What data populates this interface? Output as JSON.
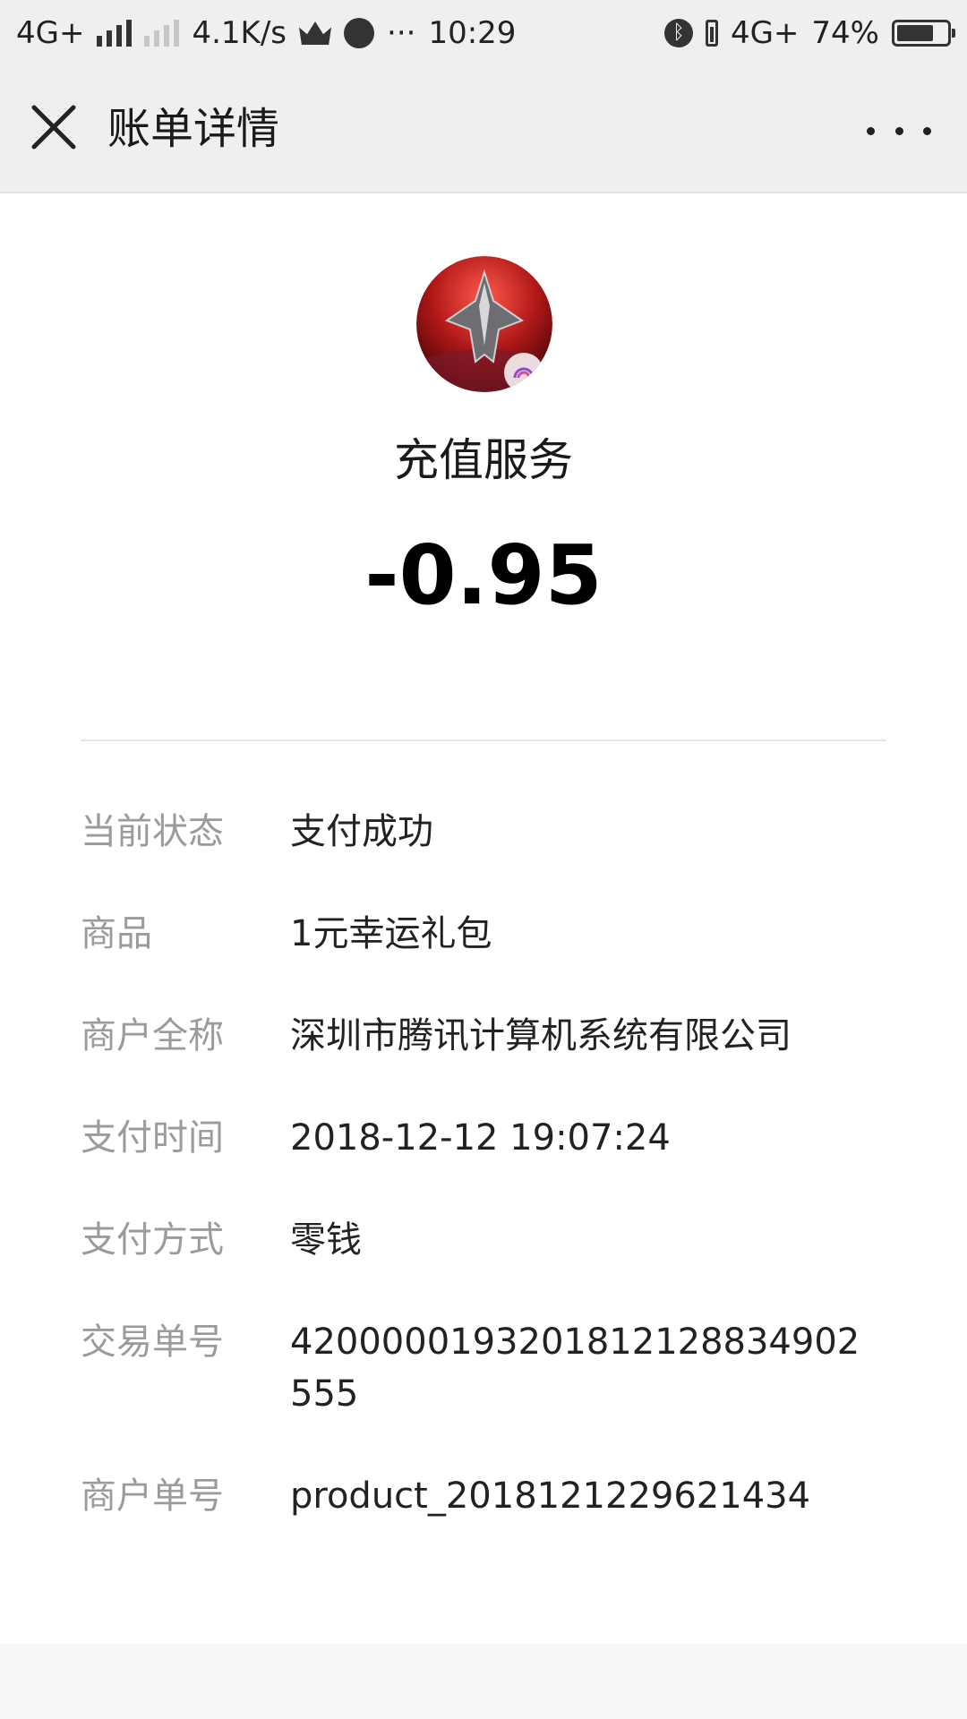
{
  "status_bar": {
    "network_left": "4G+",
    "speed": "4.1K/s",
    "time": "10:29",
    "network_right": "4G+",
    "battery_text": "74%",
    "battery_level": 0.74,
    "icons": [
      "signal-icon",
      "signal-weak-icon",
      "crown-icon",
      "browser-icon",
      "more-notifications-icon",
      "bluetooth-icon",
      "battery-icon"
    ]
  },
  "nav": {
    "title": "账单详情",
    "close_icon": "close-icon",
    "more_icon": "more-dots-icon"
  },
  "header": {
    "service_name": "充值服务",
    "amount": "-0.95",
    "avatar_icon": "game-spaceship-avatar"
  },
  "details": [
    {
      "label": "当前状态",
      "value": "支付成功"
    },
    {
      "label": "商品",
      "value": "1元幸运礼包"
    },
    {
      "label": "商户全称",
      "value": "深圳市腾讯计算机系统有限公司"
    },
    {
      "label": "支付时间",
      "value": "2018-12-12 19:07:24"
    },
    {
      "label": "支付方式",
      "value": "零钱"
    },
    {
      "label": "交易单号",
      "value": "4200000193201812128834902555"
    },
    {
      "label": "商户单号",
      "value": "product_2018121229621434"
    }
  ],
  "colors": {
    "bar_bg": "#efefef",
    "label_gray": "#9b9b9b",
    "text_dark": "#222222"
  }
}
